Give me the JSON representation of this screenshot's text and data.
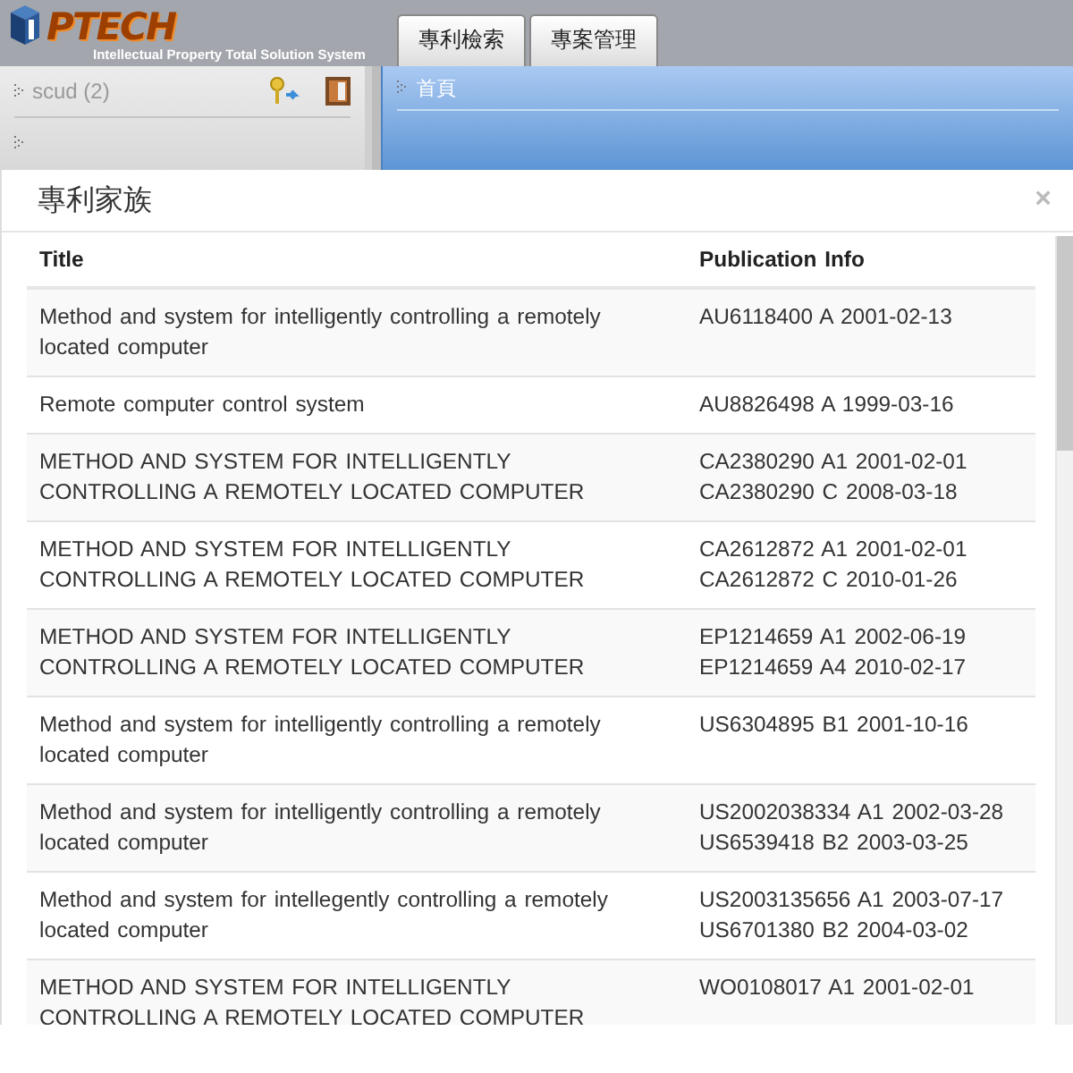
{
  "logo": {
    "text": "PTECH",
    "tagline": "Intellectual Property Total Solution System"
  },
  "tabs": [
    {
      "label": "專利檢索"
    },
    {
      "label": "專案管理"
    }
  ],
  "sidebar": {
    "user": "scud (2)"
  },
  "main": {
    "breadcrumb": "首頁"
  },
  "dialog": {
    "title": "專利家族",
    "close": "×",
    "table": {
      "columns": [
        "Title",
        "Publication Info"
      ],
      "rows": [
        {
          "title": "Method and system for intelligently controlling a remotely located computer",
          "publications": [
            "AU6118400 A 2001-02-13"
          ]
        },
        {
          "title": "Remote computer control system",
          "publications": [
            "AU8826498 A 1999-03-16"
          ]
        },
        {
          "title": "METHOD AND SYSTEM FOR INTELLIGENTLY CONTROLLING A REMOTELY LOCATED COMPUTER",
          "publications": [
            "CA2380290 A1 2001-02-01",
            "CA2380290 C 2008-03-18"
          ]
        },
        {
          "title": "METHOD AND SYSTEM FOR INTELLIGENTLY CONTROLLING A REMOTELY LOCATED COMPUTER",
          "publications": [
            "CA2612872 A1 2001-02-01",
            "CA2612872 C 2010-01-26"
          ]
        },
        {
          "title": "METHOD AND SYSTEM FOR INTELLIGENTLY CONTROLLING A REMOTELY LOCATED COMPUTER",
          "publications": [
            "EP1214659 A1 2002-06-19",
            "EP1214659 A4 2010-02-17"
          ]
        },
        {
          "title": "Method and system for intelligently controlling a remotely located computer",
          "publications": [
            "US6304895 B1 2001-10-16"
          ]
        },
        {
          "title": "Method and system for intelligently controlling a remotely located computer",
          "publications": [
            "US2002038334 A1 2002-03-28",
            "US6539418 B2 2003-03-25"
          ]
        },
        {
          "title": "Method and system for intellegently controlling a remotely located computer",
          "publications": [
            "US2003135656 A1 2003-07-17",
            "US6701380 B2 2004-03-02"
          ]
        },
        {
          "title": "METHOD AND SYSTEM FOR INTELLIGENTLY CONTROLLING A REMOTELY LOCATED COMPUTER",
          "publications": [
            "WO0108017 A1 2001-02-01"
          ]
        }
      ]
    }
  }
}
